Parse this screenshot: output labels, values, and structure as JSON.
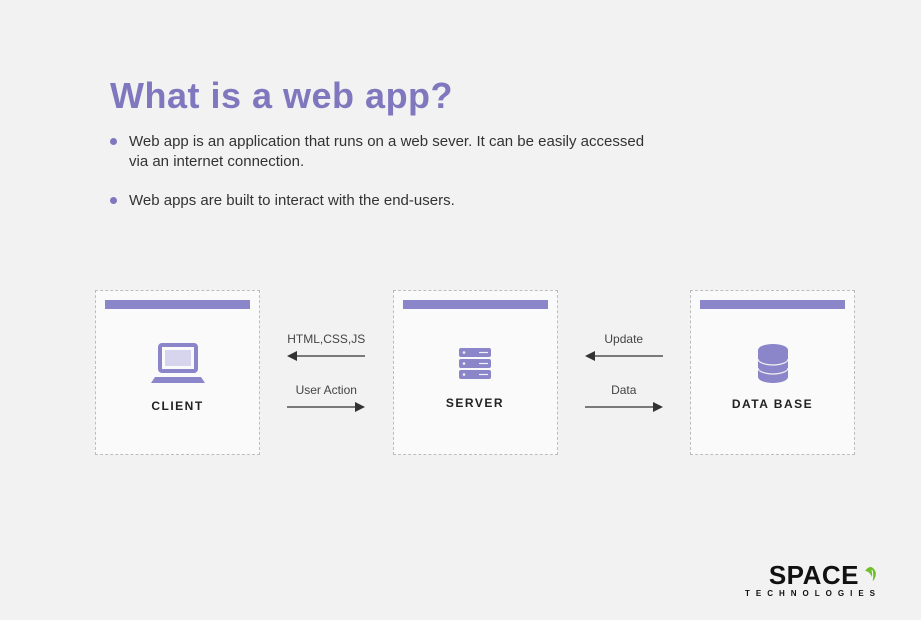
{
  "title": "What is a web app?",
  "bullets": [
    "Web app is an application that runs on a web sever. It can be easily accessed via an internet connection.",
    "Web apps are built to interact with the end-users."
  ],
  "diagram": {
    "nodes": [
      {
        "id": "client",
        "label": "CLIENT",
        "icon": "laptop-icon"
      },
      {
        "id": "server",
        "label": "SERVER",
        "icon": "server-icon"
      },
      {
        "id": "database",
        "label": "DATA BASE",
        "icon": "database-icon"
      }
    ],
    "edges": [
      {
        "from": "server",
        "to": "client",
        "label": "HTML,CSS,JS",
        "direction": "left"
      },
      {
        "from": "client",
        "to": "server",
        "label": "User Action",
        "direction": "right"
      },
      {
        "from": "database",
        "to": "server",
        "label": "Update",
        "direction": "left"
      },
      {
        "from": "server",
        "to": "database",
        "label": "Data",
        "direction": "right"
      }
    ]
  },
  "brand": {
    "name": "SPACE",
    "sub": "TECHNOLOGIES"
  },
  "colors": {
    "accent": "#7f78bf",
    "bar": "#8b85c9",
    "leaf": "#6fbf2a"
  }
}
